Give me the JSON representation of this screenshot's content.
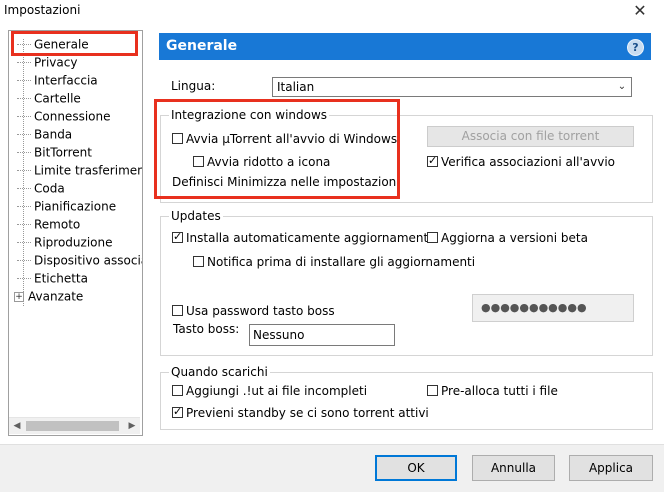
{
  "window": {
    "title": "Impostazioni",
    "close_glyph": "✕"
  },
  "tree": {
    "items": [
      {
        "label": "Generale"
      },
      {
        "label": "Privacy"
      },
      {
        "label": "Interfaccia"
      },
      {
        "label": "Cartelle"
      },
      {
        "label": "Connessione"
      },
      {
        "label": "Banda"
      },
      {
        "label": "BitTorrent"
      },
      {
        "label": "Limite trasferimento"
      },
      {
        "label": "Coda"
      },
      {
        "label": "Pianificazione"
      },
      {
        "label": "Remoto"
      },
      {
        "label": "Riproduzione"
      },
      {
        "label": "Dispositivo associato"
      },
      {
        "label": "Etichetta"
      },
      {
        "label": "Avanzate"
      }
    ],
    "expander": "+",
    "selected": "Generale"
  },
  "header": {
    "title": "Generale",
    "help_icon": "?"
  },
  "language": {
    "label": "Lingua:",
    "value": "Italian"
  },
  "windows_integration": {
    "title": "Integrazione con windows",
    "start_with_windows": {
      "label": "Avvia µTorrent all'avvio di Windows",
      "checked": false
    },
    "start_minimized": {
      "label": "Avvia ridotto a icona",
      "checked": false
    },
    "minimize_note": "Definisci Minimizza nelle impostazioni",
    "associate_button": "Associa con file torrent",
    "check_associations": {
      "label": "Verifica associazioni all'avvio",
      "checked": true
    }
  },
  "updates": {
    "title": "Updates",
    "auto_install": {
      "label": "Installa automaticamente aggiornamenti",
      "checked": true
    },
    "beta": {
      "label": "Aggiorna a versioni beta",
      "checked": false
    },
    "notify": {
      "label": "Notifica prima di installare gli aggiornamenti",
      "checked": false
    },
    "boss_password": {
      "label": "Usa password tasto boss",
      "checked": false
    },
    "password_value": "●●●●●●●●●●●",
    "boss_key_label": "Tasto boss:",
    "boss_key_value": "Nessuno"
  },
  "downloading": {
    "title": "Quando scarichi",
    "append_ut": {
      "label": "Aggiungi .!ut ai file incompleti",
      "checked": false
    },
    "preallocate": {
      "label": "Pre-alloca tutti i file",
      "checked": false
    },
    "prevent_standby": {
      "label": "Previeni standby se ci sono torrent attivi",
      "checked": true
    }
  },
  "footer": {
    "ok": "OK",
    "cancel": "Annulla",
    "apply": "Applica"
  },
  "colors": {
    "header_bg": "#1878d6",
    "highlight": "#e8301e",
    "default_button_border": "#0078d7"
  }
}
